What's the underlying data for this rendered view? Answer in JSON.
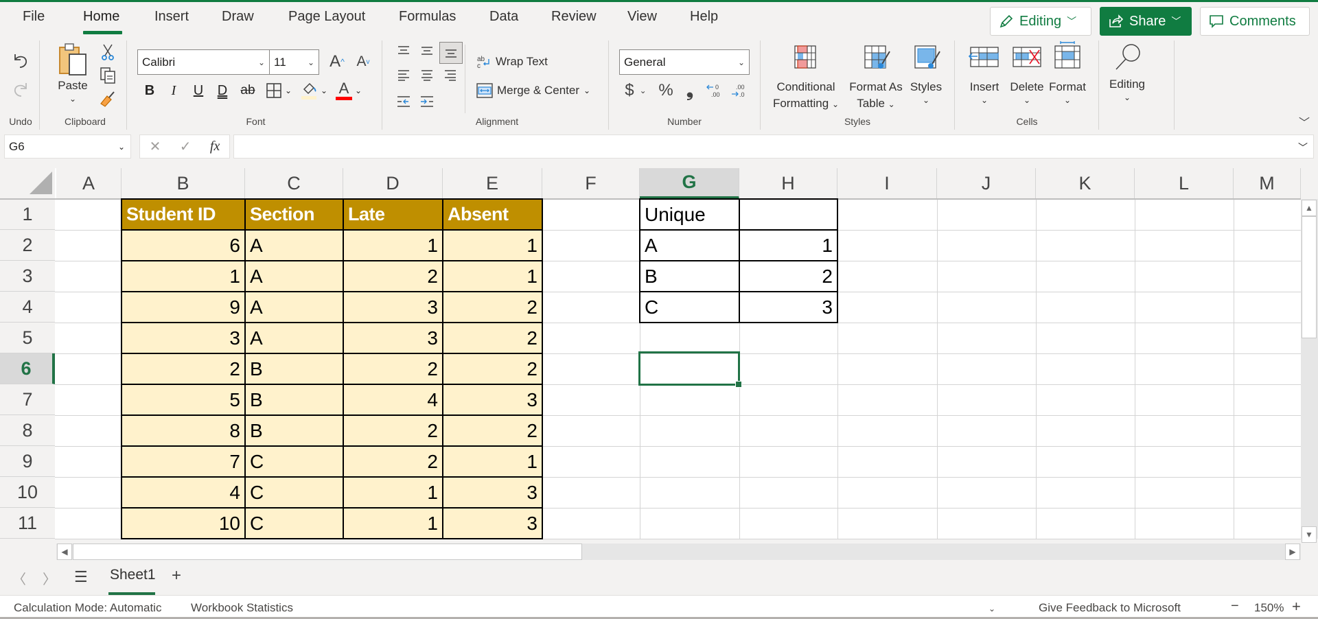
{
  "menu": {
    "tabs": [
      "File",
      "Home",
      "Insert",
      "Draw",
      "Page Layout",
      "Formulas",
      "Data",
      "Review",
      "View",
      "Help"
    ],
    "active_tab": "Home",
    "editing_label": "Editing",
    "share_label": "Share",
    "comments_label": "Comments"
  },
  "ribbon": {
    "groups": {
      "undo": "Undo",
      "clipboard": "Clipboard",
      "font": "Font",
      "alignment": "Alignment",
      "number": "Number",
      "styles": "Styles",
      "cells": "Cells"
    },
    "paste_label": "Paste",
    "font_name": "Calibri",
    "font_size": "11",
    "bold": "B",
    "italic": "I",
    "underline": "U",
    "double_underline": "D",
    "strikethrough": "ab",
    "font_color_glyph": "A",
    "grow_font": "A",
    "shrink_font": "A",
    "wrap_text": "Wrap Text",
    "merge_center": "Merge & Center",
    "number_format": "General",
    "currency": "$",
    "percent": "%",
    "comma": "❟",
    "inc_decimal": ".00",
    "dec_decimal": ".00",
    "conditional_formatting": [
      "Conditional",
      "Formatting"
    ],
    "format_as_table": [
      "Format As",
      "Table"
    ],
    "styles_label": "Styles",
    "insert_label": "Insert",
    "delete_label": "Delete",
    "format_label": "Format",
    "editing_label": "Editing",
    "colors": {
      "brand": "#107c41",
      "font_color_bar": "#ff0000",
      "fill_color_bar": "#fff2cc"
    }
  },
  "formula_bar": {
    "name_box": "G6",
    "fx_label": "fx",
    "formula": ""
  },
  "sheet": {
    "columns": [
      "A",
      "B",
      "C",
      "D",
      "E",
      "F",
      "G",
      "H",
      "I",
      "J",
      "K",
      "L",
      "M"
    ],
    "selected_column": "G",
    "rows": [
      "1",
      "2",
      "3",
      "4",
      "5",
      "6",
      "7",
      "8",
      "9",
      "10",
      "11"
    ],
    "selected_row": "6",
    "selected_cell": "G6",
    "table": {
      "headers": [
        "Student ID",
        "Section",
        "Late",
        "Absent"
      ],
      "rows": [
        [
          "6",
          "A",
          "1",
          "1"
        ],
        [
          "1",
          "A",
          "2",
          "1"
        ],
        [
          "9",
          "A",
          "3",
          "2"
        ],
        [
          "3",
          "A",
          "3",
          "2"
        ],
        [
          "2",
          "B",
          "2",
          "2"
        ],
        [
          "5",
          "B",
          "4",
          "3"
        ],
        [
          "8",
          "B",
          "2",
          "2"
        ],
        [
          "7",
          "C",
          "2",
          "1"
        ],
        [
          "4",
          "C",
          "1",
          "3"
        ],
        [
          "10",
          "C",
          "1",
          "3"
        ]
      ],
      "header_color": "#bf8f00",
      "body_color": "#fff2cc"
    },
    "unique_table": {
      "header": "Unique",
      "rows": [
        [
          "A",
          "1"
        ],
        [
          "B",
          "2"
        ],
        [
          "C",
          "3"
        ]
      ]
    }
  },
  "tabs": {
    "sheets": [
      "Sheet1"
    ],
    "active": "Sheet1",
    "add": "+"
  },
  "status": {
    "calc_mode": "Calculation Mode: Automatic",
    "workbook_stats": "Workbook Statistics",
    "feedback": "Give Feedback to Microsoft",
    "zoom": "150%",
    "zoom_out": "−",
    "zoom_in": "+"
  }
}
